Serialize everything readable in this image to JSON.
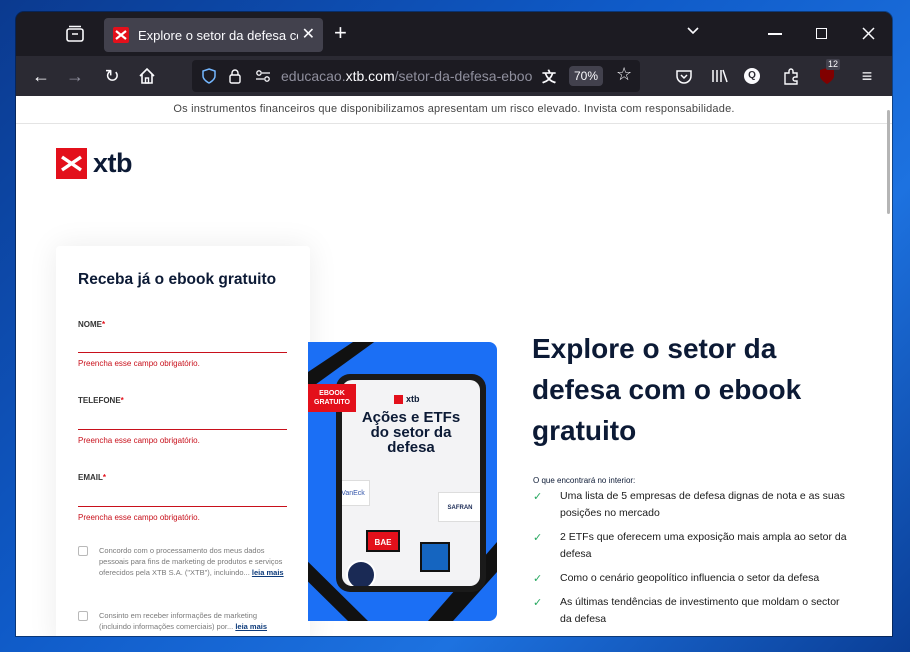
{
  "browser": {
    "tab_title": "Explore o setor da defesa com o",
    "url_prefix": "educacao.",
    "url_domain": "xtb.com",
    "url_path": "/setor-da-defesa-ebook",
    "zoom": "70%",
    "ublock_count": "12"
  },
  "page": {
    "risk_warning": "Os instrumentos financeiros que disponibilizamos apresentam um risco elevado. Invista com responsabilidade.",
    "logo_text": "xtb"
  },
  "form": {
    "title": "Receba já o ebook gratuito",
    "fields": [
      {
        "label": "NOME",
        "required": "*",
        "error": "Preencha esse campo obrigatório."
      },
      {
        "label": "TELEFONE",
        "required": "*",
        "error": "Preencha esse campo obrigatório."
      },
      {
        "label": "EMAIL",
        "required": "*",
        "error": "Preencha esse campo obrigatório."
      }
    ],
    "consent1_text": "Concordo com o processamento dos meus dados pessoais para fins de marketing de produtos e serviços oferecidos pela XTB S.A. (\"XTB\"), incluindo...",
    "consent1_link": "leia mais",
    "consent2_text": "Consinto em receber informações de marketing (incluindo informações comerciais) por...",
    "consent2_link": "leia mais"
  },
  "ebook": {
    "badge": "EBOOK GRATUITO",
    "logo": "xtb",
    "title": "Ações e ETFs do setor da defesa",
    "logo_bae": "BAE",
    "logo_safran": "SAFRAN",
    "logo_vaneck": "VanEck"
  },
  "hero": {
    "title": "Explore o setor da defesa com o ebook gratuito",
    "subtitle": "O que encontrará no interior:",
    "bullets": [
      "Uma lista de 5 empresas de defesa dignas de nota e as suas posições no mercado",
      "2 ETFs que oferecem uma exposição mais ampla ao setor da defesa",
      "Como o cenário geopolítico influencia o setor da defesa",
      "As últimas tendências de investimento que moldam o sector da defesa"
    ]
  },
  "colors": {
    "brand_red": "#e3101b",
    "navy": "#0c1a35",
    "ebook_blue": "#1b6ff5",
    "check_green": "#27a860"
  }
}
